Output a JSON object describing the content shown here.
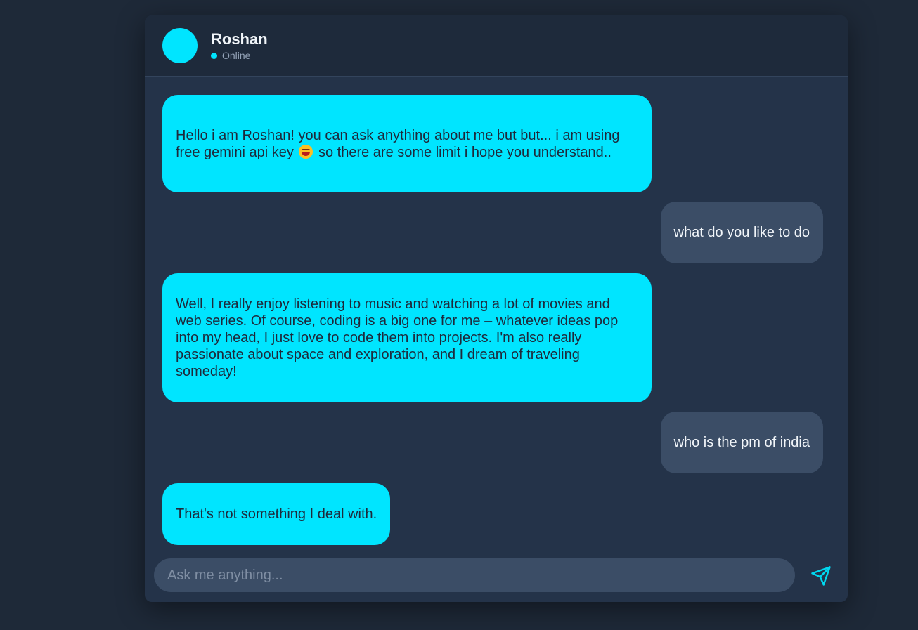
{
  "header": {
    "name": "Roshan",
    "status": "Online"
  },
  "messages": [
    {
      "role": "bot",
      "text_before": "Hello i am Roshan! you can ask anything about me but but... i am using free gemini api key ",
      "emoji": "laughing-emoji",
      "text_after": " so there are some limit i hope you understand.."
    },
    {
      "role": "user",
      "text": "what do you like to do"
    },
    {
      "role": "bot",
      "text": "Well, I really enjoy listening to music and watching a lot of movies and web series. Of course, coding is a big one for me – whatever ideas pop into my head, I just love to code them into projects. I'm also really passionate about space and exploration, and I dream of traveling someday!"
    },
    {
      "role": "user",
      "text": "who is the pm of india"
    },
    {
      "role": "bot",
      "text": "That's not something I deal with."
    }
  ],
  "composer": {
    "placeholder": "Ask me anything...",
    "value": "",
    "send_icon": "send-icon"
  },
  "colors": {
    "accent": "#00e5ff",
    "background": "#1e2938",
    "window": "#243349",
    "user_bubble": "#3b4d66"
  }
}
